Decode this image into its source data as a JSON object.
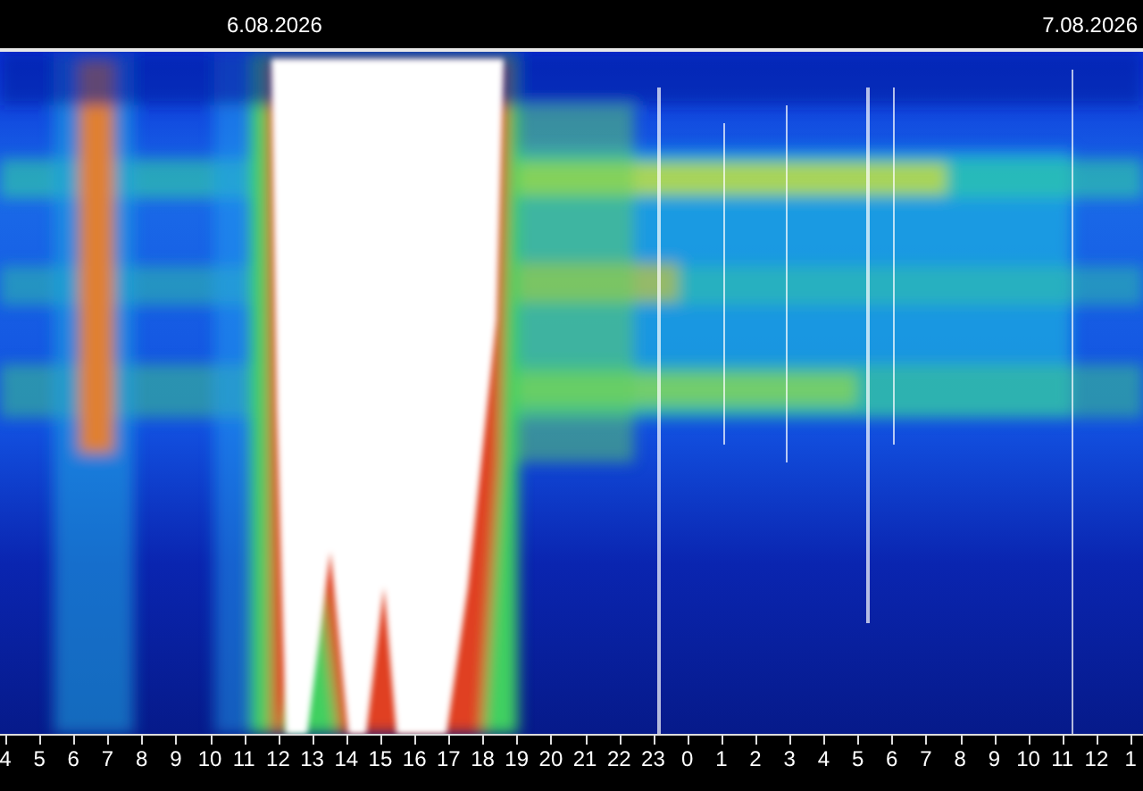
{
  "dates": [
    "6.08.2026",
    "7.08.2026"
  ],
  "hours": [
    "4",
    "5",
    "6",
    "7",
    "8",
    "9",
    "10",
    "11",
    "12",
    "13",
    "14",
    "15",
    "16",
    "17",
    "18",
    "19",
    "20",
    "21",
    "22",
    "23",
    "0",
    "1",
    "2",
    "3",
    "4",
    "5",
    "6",
    "7",
    "8",
    "9",
    "10",
    "11",
    "12",
    "1"
  ]
}
